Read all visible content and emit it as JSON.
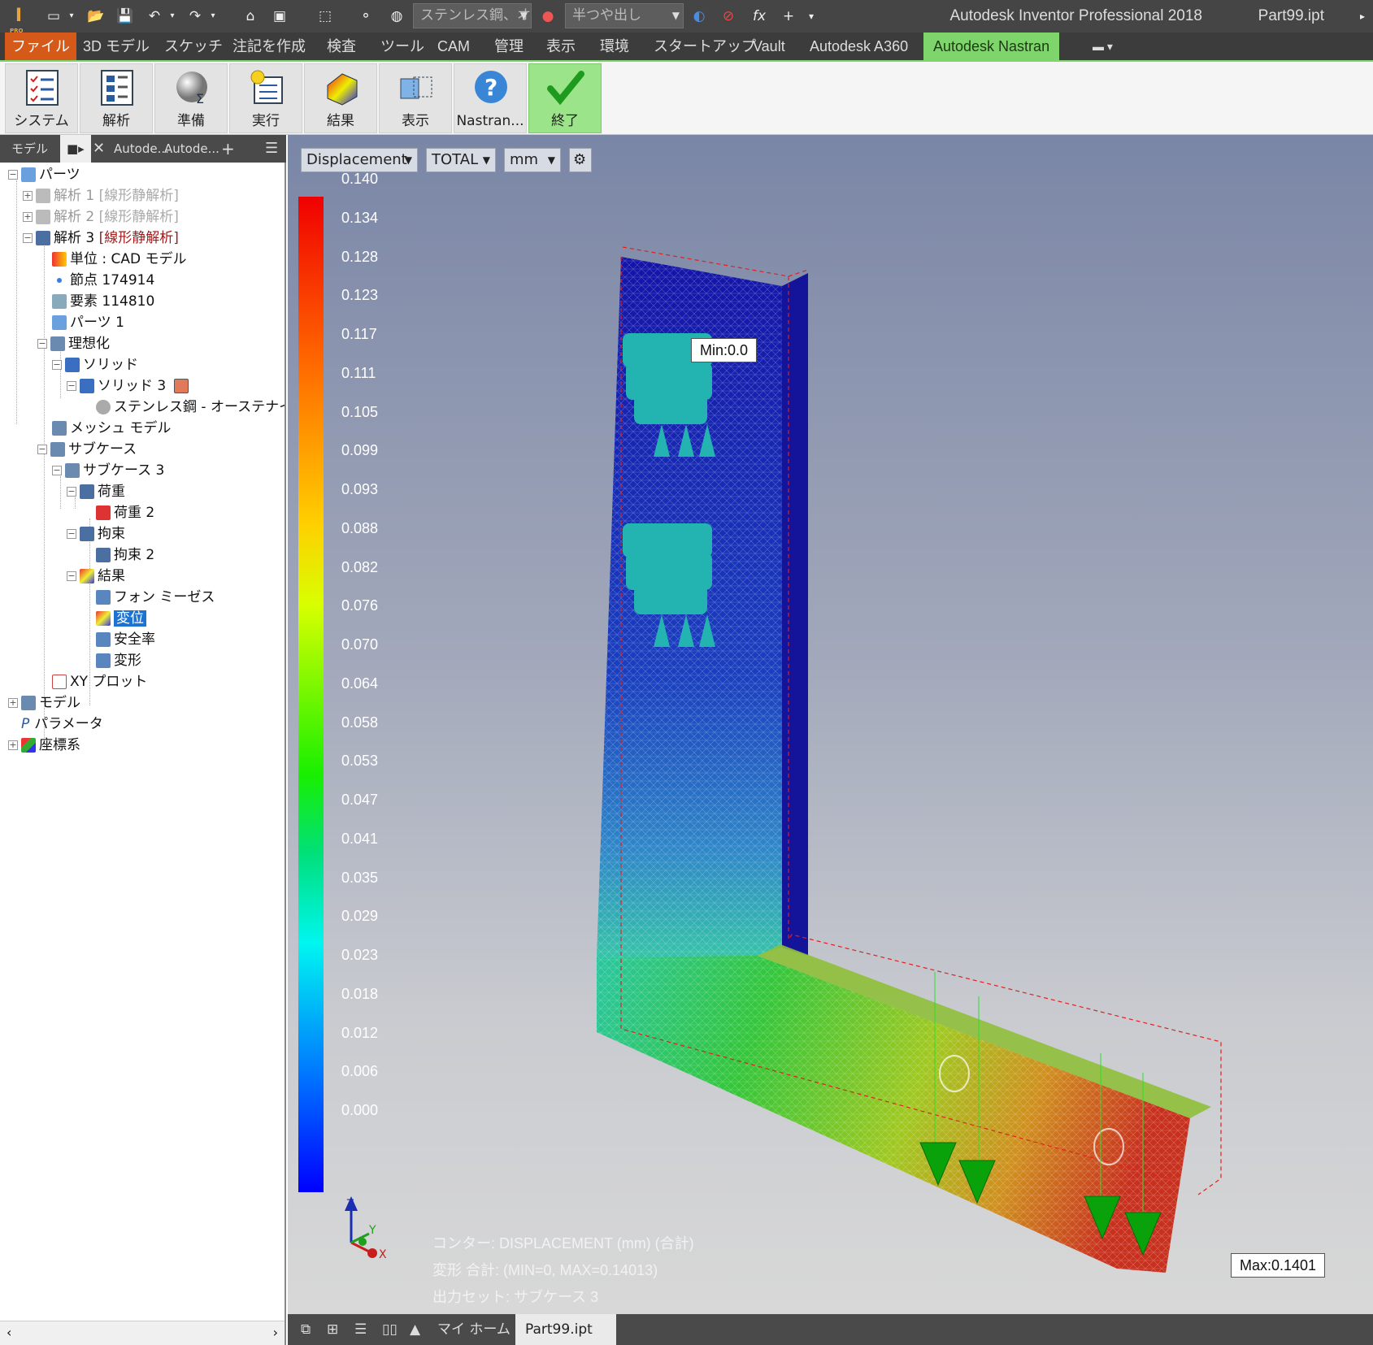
{
  "app": {
    "title": "Autodesk Inventor Professional 2018",
    "document": "Part99.ipt",
    "pro_badge": "PRO",
    "material_combo": "ステンレス鋼、オ",
    "appearance_combo": "半つや出し"
  },
  "menu": {
    "tabs": [
      "ファイル",
      "3D モデル",
      "スケッチ",
      "注記を作成",
      "検査",
      "ツール",
      "CAM",
      "管理",
      "表示",
      "環境",
      "スタートアップ",
      "Vault",
      "Autodesk A360",
      "Autodesk Nastran"
    ],
    "active": "Autodesk Nastran"
  },
  "ribbon": {
    "buttons": [
      "システム",
      "解析",
      "準備",
      "実行",
      "結果",
      "表示",
      "Nastran...",
      "終了"
    ]
  },
  "browser": {
    "tab_model": "モデル",
    "tab_a": "Autode...",
    "tab_b": "Autode...",
    "tree": {
      "root": "パーツ",
      "an1": "解析 1",
      "an1_type": "[線形静解析]",
      "an2": "解析 2",
      "an2_type": "[線形静解析]",
      "an3": "解析 3",
      "an3_type": "[線形静解析]",
      "units": "単位 : CAD モデル",
      "nodes": "節点 174914",
      "elements": "要素 114810",
      "parts1": "パーツ 1",
      "idealization": "理想化",
      "solid": "ソリッド",
      "solid3": "ソリッド 3",
      "material": "ステンレス鋼 - オーステナイト系",
      "mesh": "メッシュ モデル",
      "subcases": "サブケース",
      "subcase3": "サブケース 3",
      "loads": "荷重",
      "load2": "荷重 2",
      "constraints": "拘束",
      "constraint2": "拘束 2",
      "results": "結果",
      "vonmises": "フォン ミーゼス",
      "displacement": "変位",
      "safety": "安全率",
      "deform": "変形",
      "xyplot": "XY プロット",
      "model": "モデル",
      "params": "パラメータ",
      "coords": "座標系"
    }
  },
  "viewport": {
    "result_type": "Displacement",
    "component": "TOTAL",
    "unit": "mm",
    "legend": [
      "0.140",
      "0.134",
      "0.128",
      "0.123",
      "0.117",
      "0.111",
      "0.105",
      "0.099",
      "0.093",
      "0.088",
      "0.082",
      "0.076",
      "0.070",
      "0.064",
      "0.058",
      "0.053",
      "0.047",
      "0.041",
      "0.035",
      "0.029",
      "0.023",
      "0.018",
      "0.012",
      "0.006",
      "0.000"
    ],
    "min_label": "Min:0.0",
    "max_label": "Max:0.1401",
    "info_contour": "コンター: DISPLACEMENT (mm) (合計)",
    "info_deform": "変形 合計: (MIN=0, MAX=0.14013)",
    "info_output": "出力セット: サブケース 3",
    "axis_z": "Z",
    "axis_y": "Y",
    "axis_x": "X"
  },
  "bottom": {
    "tab_home": "マイ ホーム",
    "tab_doc": "Part99.ipt"
  }
}
